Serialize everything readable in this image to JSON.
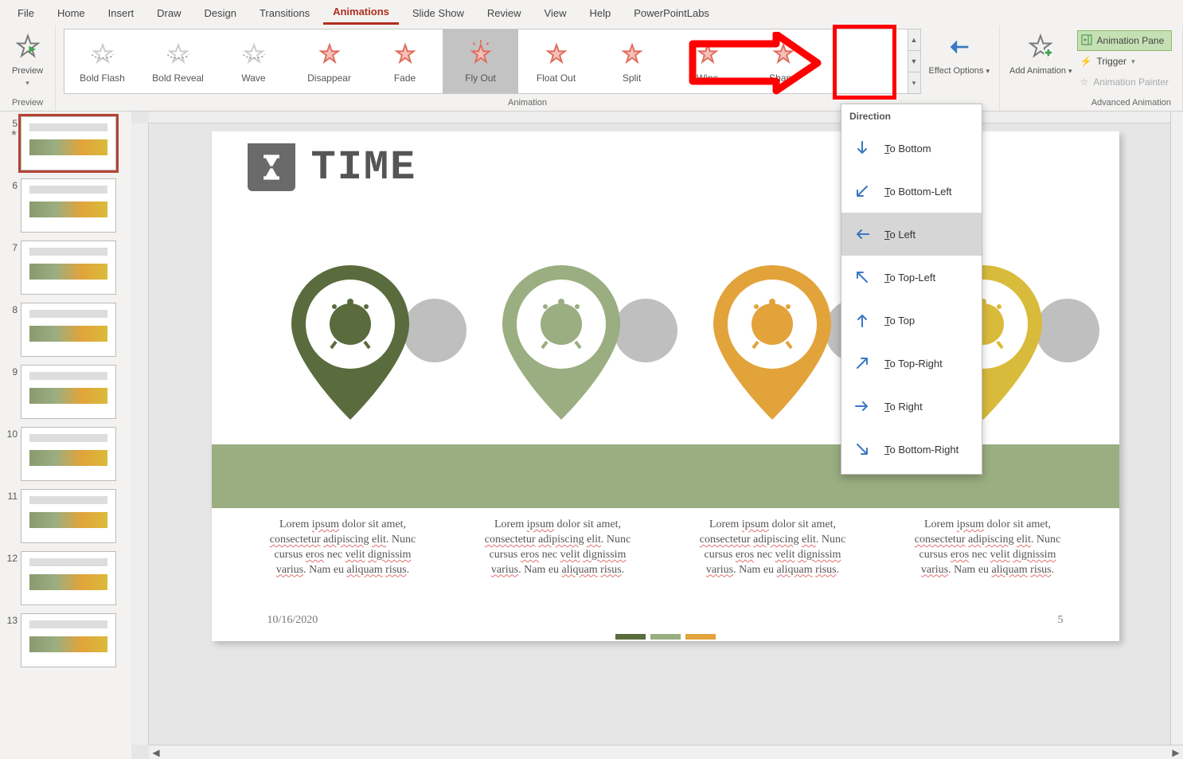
{
  "tabs": [
    "File",
    "Home",
    "Insert",
    "Draw",
    "Design",
    "Transitions",
    "Animations",
    "Slide Show",
    "Review",
    "View",
    "Help",
    "PowerPointLabs"
  ],
  "active_tab": "Animations",
  "ribbon": {
    "preview_group_label": "Preview",
    "preview_label": "Preview",
    "animation_group_label": "Animation",
    "gallery": [
      {
        "label": "Bold Flash",
        "color": "#ccc"
      },
      {
        "label": "Bold Reveal",
        "color": "#ccc"
      },
      {
        "label": "Wave",
        "color": "#ccc"
      },
      {
        "label": "Disappear",
        "color": "#e06b5b"
      },
      {
        "label": "Fade",
        "color": "#e06b5b"
      },
      {
        "label": "Fly Out",
        "color": "#e06b5b",
        "selected": true
      },
      {
        "label": "Float Out",
        "color": "#e06b5b"
      },
      {
        "label": "Split",
        "color": "#e06b5b"
      },
      {
        "label": "Wipe",
        "color": "#e06b5b"
      },
      {
        "label": "Shape",
        "color": "#e06b5b"
      }
    ],
    "effect_options_label": "Effect Options",
    "add_animation_label": "Add Animation",
    "adv_group_label": "Advanced Animation",
    "animation_pane_label": "Animation Pane",
    "trigger_label": "Trigger",
    "animation_painter_label": "Animation Painter"
  },
  "effect_menu": {
    "header": "Direction",
    "items": [
      {
        "label": "To Bottom",
        "dir": "s"
      },
      {
        "label": "To Bottom-Left",
        "dir": "sw"
      },
      {
        "label": "To Left",
        "dir": "w",
        "selected": true
      },
      {
        "label": "To Top-Left",
        "dir": "nw"
      },
      {
        "label": "To Top",
        "dir": "n"
      },
      {
        "label": "To Top-Right",
        "dir": "ne"
      },
      {
        "label": "To Right",
        "dir": "e"
      },
      {
        "label": "To Bottom-Right",
        "dir": "se"
      }
    ]
  },
  "slide": {
    "title": "TIME",
    "paragraph": "Lorem ipsum dolor sit amet, consectetur adipiscing elit. Nunc cursus eros nec velit dignissim varius. Nam eu aliquam risus.",
    "date": "10/16/2020",
    "page": "5",
    "pin_colors": [
      "#5a6b3d",
      "#9aae81",
      "#e2a33b",
      "#d9bb3b"
    ],
    "tab_colors": [
      "#5a6b3d",
      "#9aae81",
      "#e2a33b"
    ]
  },
  "current_slide_number": "5",
  "thumb_numbers": [
    "5",
    "6",
    "7",
    "8",
    "9",
    "10",
    "11",
    "12",
    "13"
  ]
}
